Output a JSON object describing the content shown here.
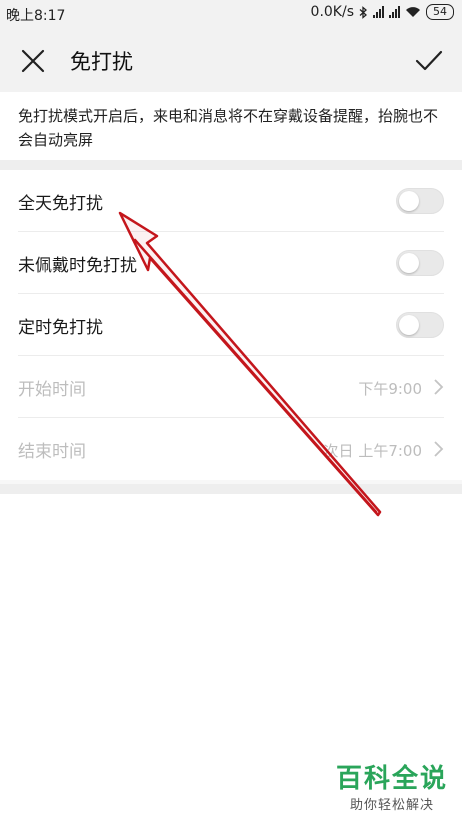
{
  "status_bar": {
    "time": "晚上8:17",
    "network_speed": "0.0K/s",
    "battery": "54"
  },
  "header": {
    "title": "免打扰"
  },
  "description": "免打扰模式开启后，来电和消息将不在穿戴设备提醒，抬腕也不会自动亮屏",
  "settings": {
    "all_day": {
      "label": "全天免打扰",
      "on": false
    },
    "not_worn": {
      "label": "未佩戴时免打扰",
      "on": false
    },
    "scheduled": {
      "label": "定时免打扰",
      "on": false
    },
    "start_time": {
      "label": "开始时间",
      "value": "下午9:00"
    },
    "end_time": {
      "label": "结束时间",
      "value": "次日 上午7:00"
    }
  },
  "watermark": {
    "brand": "百科全说",
    "slogan": "助你轻松解决"
  },
  "colors": {
    "annotation_arrow": "#c4161c",
    "watermark_green": "#2aa55a",
    "disabled_text": "#bdbdbd"
  }
}
